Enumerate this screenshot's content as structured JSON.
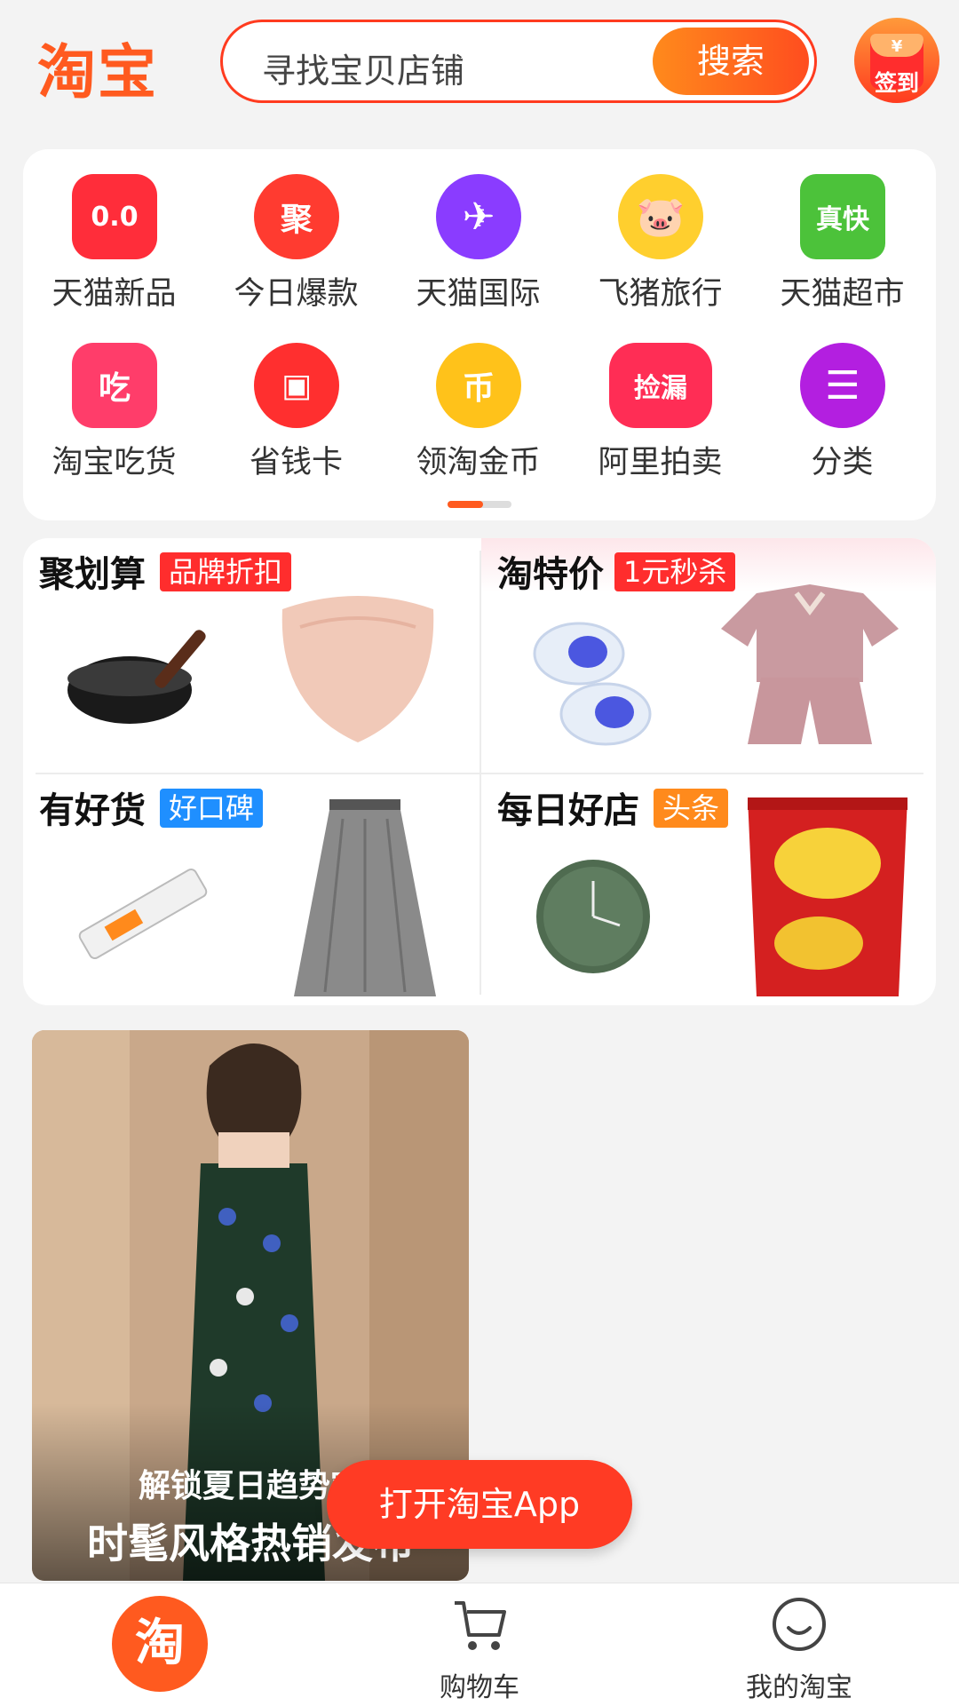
{
  "header": {
    "logo": "淘宝",
    "search_placeholder": "寻找宝贝店铺",
    "search_button": "搜索",
    "signin_label": "签到",
    "signin_icon_text": "¥"
  },
  "grid": {
    "items": [
      {
        "label": "天猫新品",
        "icon_text": "0.0",
        "color": "#ff2d3a"
      },
      {
        "label": "今日爆款",
        "icon_text": "聚",
        "color": "#ff3b30"
      },
      {
        "label": "天猫国际",
        "icon_text": "✈",
        "color": "#8a3cff"
      },
      {
        "label": "飞猪旅行",
        "icon_text": "🐷",
        "color": "#ffcf2e"
      },
      {
        "label": "天猫超市",
        "icon_text": "真快",
        "color": "#4cc23a"
      },
      {
        "label": "淘宝吃货",
        "icon_text": "吃",
        "color": "#ff3d6a"
      },
      {
        "label": "省钱卡",
        "icon_text": "▣",
        "color": "#ff2f2f"
      },
      {
        "label": "领淘金币",
        "icon_text": "币",
        "color": "#ffc21a"
      },
      {
        "label": "阿里拍卖",
        "icon_text": "捡漏",
        "color": "#ff2d55"
      },
      {
        "label": "分类",
        "icon_text": "☰",
        "color": "#b31fe0"
      }
    ]
  },
  "promo": {
    "cells": [
      {
        "title": "聚划算",
        "tag": "品牌折扣",
        "tag_color": "#ff2d2d"
      },
      {
        "title": "淘特价",
        "tag": "1元秒杀",
        "tag_color": "#ff2d2d"
      },
      {
        "title": "有好货",
        "tag": "好口碑",
        "tag_color": "#1f8fff"
      },
      {
        "title": "每日好店",
        "tag": "头条",
        "tag_color": "#ff8a1c"
      }
    ]
  },
  "feed": {
    "caption_line1": "解锁夏日趋势穿",
    "caption_line2": "时髦风格热销发布"
  },
  "open_app_button": "打开淘宝App",
  "tabbar": {
    "home_icon_text": "淘",
    "cart_label": "购物车",
    "mine_label": "我的淘宝"
  },
  "colors": {
    "brand": "#ff5a1f",
    "search_border": "#ff3b1f"
  }
}
